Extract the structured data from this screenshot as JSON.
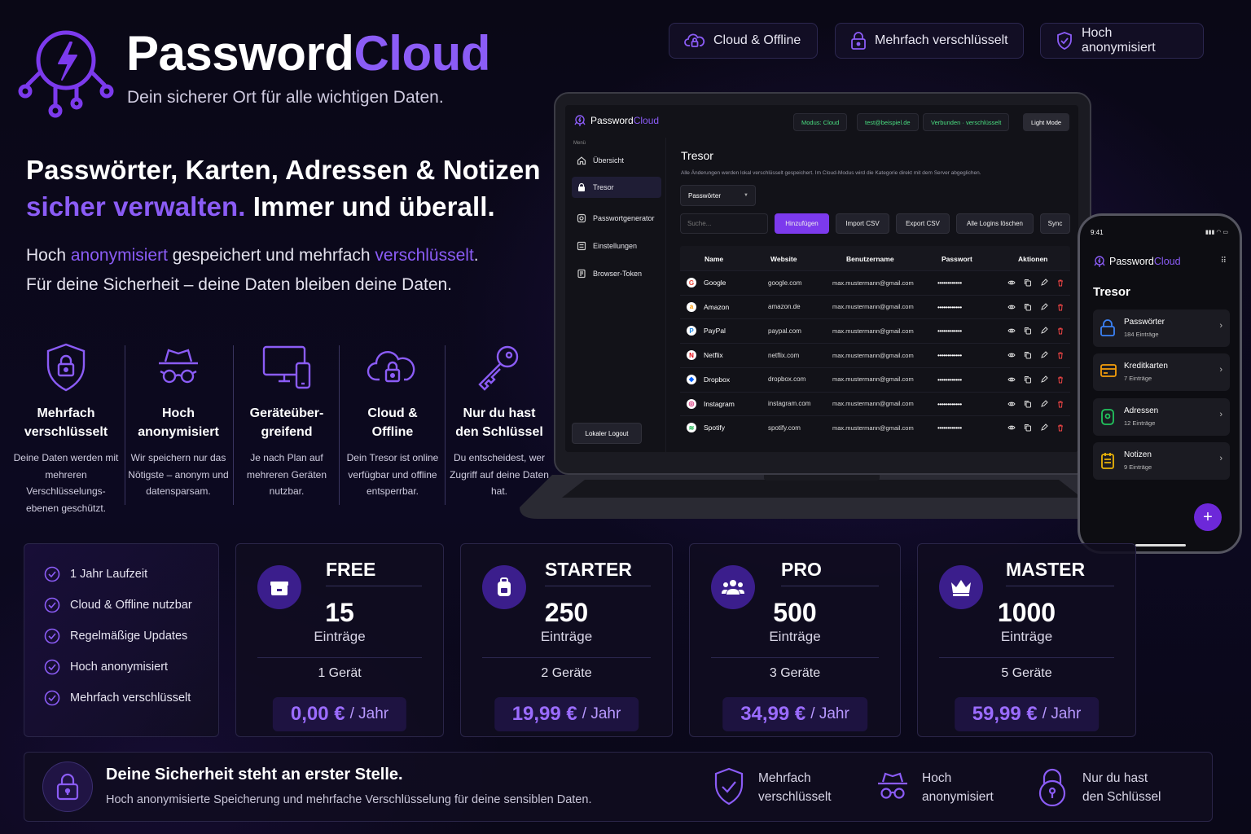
{
  "brand": {
    "name_a": "Password",
    "name_b": "Cloud",
    "tagline": "Dein sicherer Ort für alle wichtigen Daten."
  },
  "pills": [
    "Cloud & Offline",
    "Mehrfach verschlüsselt",
    "Hoch anonymisiert"
  ],
  "hero": {
    "line1": "Passwörter, Karten, Adressen & Notizen",
    "line2_accent": "sicher verwalten.",
    "line2_rest": " Immer und überall.",
    "lead_1a": "Hoch ",
    "lead_1b": "anonymisiert",
    "lead_1c": " gespeichert und mehrfach ",
    "lead_1d": "verschlüsselt",
    "lead_1e": ".",
    "lead_2": "Für deine Sicherheit – deine Daten bleiben deine Daten."
  },
  "features": [
    {
      "t1": "Mehrfach",
      "t2": "verschlüsselt",
      "d": "Deine Daten werden mit mehreren Verschlüsselungs-ebenen geschützt."
    },
    {
      "t1": "Hoch",
      "t2": "anonymisiert",
      "d": "Wir speichern nur das Nötigste – anonym und datensparsam."
    },
    {
      "t1": "Geräteüber-",
      "t2": "greifend",
      "d": "Je nach Plan auf mehreren Geräten nutzbar."
    },
    {
      "t1": "Cloud &",
      "t2": "Offline",
      "d": "Dein Tresor ist online verfügbar und offline entsperrbar."
    },
    {
      "t1": "Nur du hast",
      "t2": "den Schlüssel",
      "d": "Du entscheidest, wer Zugriff auf deine Daten hat."
    }
  ],
  "benefits": [
    "1 Jahr Laufzeit",
    "Cloud & Offline nutzbar",
    "Regelmäßige Updates",
    "Hoch anonymisiert",
    "Mehrfach verschlüsselt"
  ],
  "plans": [
    {
      "name": "FREE",
      "num": "15",
      "unit": "Einträge",
      "devices": "1 Gerät",
      "price": "0,00 €",
      "per": "/ Jahr"
    },
    {
      "name": "STARTER",
      "num": "250",
      "unit": "Einträge",
      "devices": "2 Geräte",
      "price": "19,99 €",
      "per": "/ Jahr"
    },
    {
      "name": "PRO",
      "num": "500",
      "unit": "Einträge",
      "devices": "3 Geräte",
      "price": "34,99 €",
      "per": "/ Jahr"
    },
    {
      "name": "MASTER",
      "num": "1000",
      "unit": "Einträge",
      "devices": "5 Geräte",
      "price": "59,99 €",
      "per": "/ Jahr"
    }
  ],
  "footer": {
    "title": "Deine Sicherheit steht an erster Stelle.",
    "text": "Hoch anonymisierte Speicherung und mehrfache Verschlüsselung für deine sensiblen Daten.",
    "items": [
      {
        "a": "Mehrfach",
        "b": "verschlüsselt"
      },
      {
        "a": "Hoch",
        "b": "anonymisiert"
      },
      {
        "a": "Nur du hast",
        "b": "den Schlüssel"
      }
    ]
  },
  "app": {
    "brand_a": "Password",
    "brand_b": "Cloud",
    "tags": [
      "Modus: Cloud",
      "test@beispiel.de",
      "Verbunden · verschlüsselt"
    ],
    "light_mode": "Light Mode",
    "menu_label": "Menü",
    "nav": [
      "Übersicht",
      "Tresor",
      "Passwortgenerator",
      "Einstellungen",
      "Browser-Token"
    ],
    "logout": "Lokaler Logout",
    "title": "Tresor",
    "hint": "Alle Änderungen werden lokal verschlüsselt gespeichert. Im Cloud-Modus wird die Kategorie direkt mit dem Server abgeglichen.",
    "category": "Passwörter",
    "search_placeholder": "Suche...",
    "buttons": [
      "Hinzufügen",
      "Import CSV",
      "Export CSV",
      "Alle Logins löschen",
      "Sync"
    ],
    "columns": [
      "Name",
      "Website",
      "Benutzername",
      "Passwort",
      "Aktionen"
    ],
    "rows": [
      {
        "name": "Google",
        "site": "google.com",
        "user": "max.mustermann@gmail.com",
        "pw": "••••••••••••",
        "logo": "G",
        "color": "#ea4335"
      },
      {
        "name": "Amazon",
        "site": "amazon.de",
        "user": "max.mustermann@gmail.com",
        "pw": "••••••••••••",
        "logo": "a",
        "color": "#ff9900"
      },
      {
        "name": "PayPal",
        "site": "paypal.com",
        "user": "max.mustermann@gmail.com",
        "pw": "••••••••••••",
        "logo": "P",
        "color": "#1e88e5"
      },
      {
        "name": "Netflix",
        "site": "netflix.com",
        "user": "max.mustermann@gmail.com",
        "pw": "••••••••••••",
        "logo": "N",
        "color": "#e50914"
      },
      {
        "name": "Dropbox",
        "site": "dropbox.com",
        "user": "max.mustermann@gmail.com",
        "pw": "••••••••••••",
        "logo": "◆",
        "color": "#0061ff"
      },
      {
        "name": "Instagram",
        "site": "instagram.com",
        "user": "max.mustermann@gmail.com",
        "pw": "••••••••••••",
        "logo": "◎",
        "color": "#d62976"
      },
      {
        "name": "Spotify",
        "site": "spotify.com",
        "user": "max.mustermann@gmail.com",
        "pw": "••••••••••••",
        "logo": "≋",
        "color": "#1db954"
      }
    ]
  },
  "phone": {
    "time": "9:41",
    "brand_a": "Password",
    "brand_b": "Cloud",
    "title": "Tresor",
    "items": [
      {
        "label": "Passwörter",
        "count": "184 Einträge",
        "color": "#3b82f6"
      },
      {
        "label": "Kreditkarten",
        "count": "7 Einträge",
        "color": "#f59e0b"
      },
      {
        "label": "Adressen",
        "count": "12 Einträge",
        "color": "#22c55e"
      },
      {
        "label": "Notizen",
        "count": "9 Einträge",
        "color": "#eab308"
      }
    ],
    "fab": "+"
  },
  "colors": {
    "accent": "#8b5cf6",
    "bg": "#090713"
  }
}
